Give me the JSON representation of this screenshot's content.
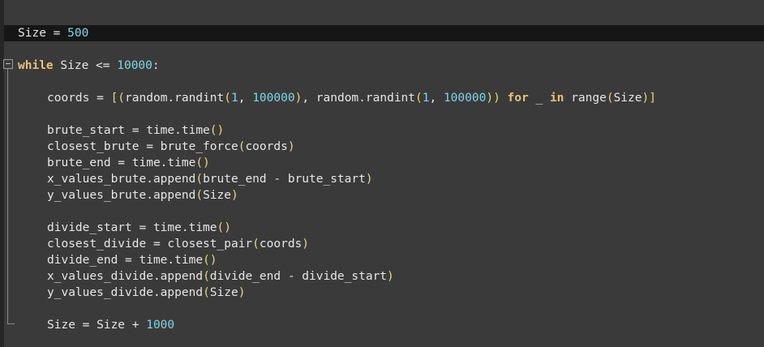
{
  "editor": {
    "lines": [
      {
        "id": "l1",
        "tokens": [
          "Size",
          " = ",
          "500"
        ]
      },
      {
        "id": "l2",
        "tokens": [
          "while",
          " Size <= ",
          "10000",
          ":"
        ]
      },
      {
        "id": "l3",
        "tokens": [
          "coords = ",
          "[(",
          "random.randint",
          "(",
          "1",
          ", ",
          "100000",
          ")",
          ", random.randint",
          "(",
          "1",
          ", ",
          "100000",
          "))",
          " ",
          "for",
          " _ ",
          "in",
          " range",
          "(",
          "Size",
          ")]"
        ]
      },
      {
        "id": "l4",
        "tokens": [
          "brute_start = time.time",
          "()"
        ]
      },
      {
        "id": "l5",
        "tokens": [
          "closest_brute = brute_force",
          "(",
          "coords",
          ")"
        ]
      },
      {
        "id": "l6",
        "tokens": [
          "brute_end = time.time",
          "()"
        ]
      },
      {
        "id": "l7",
        "tokens": [
          "x_values_brute.append",
          "(",
          "brute_end - brute_start",
          ")"
        ]
      },
      {
        "id": "l8",
        "tokens": [
          "y_values_brute.append",
          "(",
          "Size",
          ")"
        ]
      },
      {
        "id": "l9",
        "tokens": [
          "divide_start = time.time",
          "()"
        ]
      },
      {
        "id": "l10",
        "tokens": [
          "closest_divide = closest_pair",
          "(",
          "coords",
          ")"
        ]
      },
      {
        "id": "l11",
        "tokens": [
          "divide_end = time.time",
          "()"
        ]
      },
      {
        "id": "l12",
        "tokens": [
          "x_values_divide.append",
          "(",
          "divide_end - divide_start",
          ")"
        ]
      },
      {
        "id": "l13",
        "tokens": [
          "y_values_divide.append",
          "(",
          "Size",
          ")"
        ]
      },
      {
        "id": "l14",
        "tokens": [
          "Size = Size + ",
          "1000"
        ]
      }
    ]
  },
  "colors": {
    "background": "#3a3a3a",
    "current_line": "#161616",
    "keyword": "#e5c07b",
    "number": "#7fd6e6",
    "text": "#e6e6e6",
    "paren": "#e6db74"
  },
  "icons": {
    "fold": "fold-collapse-icon"
  }
}
